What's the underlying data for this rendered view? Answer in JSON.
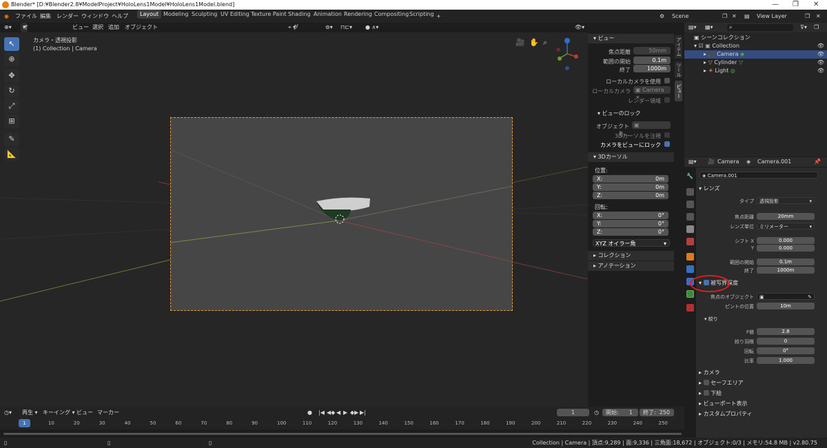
{
  "window": {
    "title": "Blender* [D:¥Blender2.8¥ModelProject¥HoloLens1Model¥HoloLens1Model.blend]"
  },
  "menu": {
    "items": [
      "ファイル",
      "編集",
      "レンダー",
      "ウィンドウ",
      "ヘルプ"
    ]
  },
  "workspaces": [
    "Layout",
    "Modeling",
    "Sculpting",
    "UV Editing",
    "Texture Paint",
    "Shading",
    "Animation",
    "Rendering",
    "Compositing",
    "Scripting"
  ],
  "scene": {
    "name": "Scene",
    "view_layer": "View Layer"
  },
  "viewport_header": {
    "mode": "オブジェク...",
    "menus": [
      "ビュー",
      "選択",
      "追加",
      "オブジェクト"
    ],
    "orientation": "グロー..."
  },
  "viewport": {
    "view_name": "カメラ・透視投影",
    "collection_label": "(1) Collection | Camera"
  },
  "npanel": {
    "view_section": "ビュー",
    "focal_length_label": "焦点距離",
    "focal_length": "50mm",
    "clip_start_label": "範囲の開始",
    "clip_start": "0.1m",
    "clip_end_label": "終了",
    "clip_end": "1000m",
    "local_camera_use": "ローカルカメラを使用",
    "local_camera_label": "ローカルカメラ",
    "local_camera_value": "Camera",
    "render_region": "レンダー領域",
    "view_lock_section": "ビューのロック",
    "lock_object_label": "オブジェクトを...",
    "lock_3dcursor": "3Dカーソルを注視",
    "lock_camera_to_view": "カメラをビューにロック",
    "cursor_section": "3Dカーソル",
    "location_label": "位置:",
    "x_label": "X:",
    "y_label": "Y:",
    "z_label": "Z:",
    "loc_x": "0m",
    "loc_y": "0m",
    "loc_z": "0m",
    "rotation_label": "回転:",
    "rot_x": "0°",
    "rot_y": "0°",
    "rot_z": "0°",
    "rotation_mode": "XYZ オイラー角",
    "collection_section": "コレクション",
    "annotation_section": "アノテーション",
    "tabs": [
      "アイテム",
      "ツール",
      "ビュー"
    ]
  },
  "outliner": {
    "root": "シーンコレクション",
    "items": [
      {
        "name": "Collection"
      },
      {
        "name": "Camera"
      },
      {
        "name": "Cylinder"
      },
      {
        "name": "Light"
      }
    ]
  },
  "properties": {
    "header_object": "Camera",
    "header_data": "Camera.001",
    "data_name": "Camera.001",
    "lens_section": "レンズ",
    "type_label": "タイプ",
    "type_value": "透視投影",
    "focal_label": "焦点距離",
    "focal_value": "20mm",
    "lens_unit_label": "レンズ単位",
    "lens_unit_value": "ミリメーター",
    "shift_x_label": "シフト X",
    "shift_x": "0.000",
    "shift_y_label": "Y",
    "shift_y": "0.000",
    "clip_start_label": "範囲の開始",
    "clip_start": "0.1m",
    "clip_end_label": "終了",
    "clip_end": "1000m",
    "dof_section": "被写界深度",
    "focus_object_label": "焦点のオブジェクト",
    "focus_distance_label": "ピントの位置",
    "focus_distance": "10m",
    "aperture_section": "絞り",
    "fstop_label": "F値",
    "fstop": "2.8",
    "blades_label": "絞り羽根",
    "blades": "0",
    "rotation_label": "回転",
    "rotation": "0°",
    "ratio_label": "比率",
    "ratio": "1.000",
    "camera_section": "カメラ",
    "safe_areas_section": "セーフエリア",
    "background_section": "下絵",
    "viewport_display_section": "ビューポート表示",
    "custom_props_section": "カスタムプロパティ"
  },
  "timeline": {
    "playback": "再生",
    "keying": "キーイング",
    "view": "ビュー",
    "marker": "マーカー",
    "current_frame": "1",
    "start_label": "開始:",
    "start": "1",
    "end_label": "終了:",
    "end": "250",
    "ticks": [
      "1",
      "10",
      "20",
      "30",
      "40",
      "50",
      "60",
      "70",
      "80",
      "90",
      "100",
      "110",
      "120",
      "130",
      "140",
      "150",
      "160",
      "170",
      "180",
      "190",
      "200",
      "210",
      "220",
      "230",
      "240",
      "250"
    ]
  },
  "status_bar": {
    "text": "Collection | Camera | 頂点:9,289 | 面:9,336 | 三角面:18,672 | オブジェクト:0/3 | メモリ:54.8 MB | v2.80.75"
  },
  "colors": {
    "accent": "#4772b3",
    "camera_frame": "#e09a3a",
    "highlight_ring": "#e01d1d"
  }
}
